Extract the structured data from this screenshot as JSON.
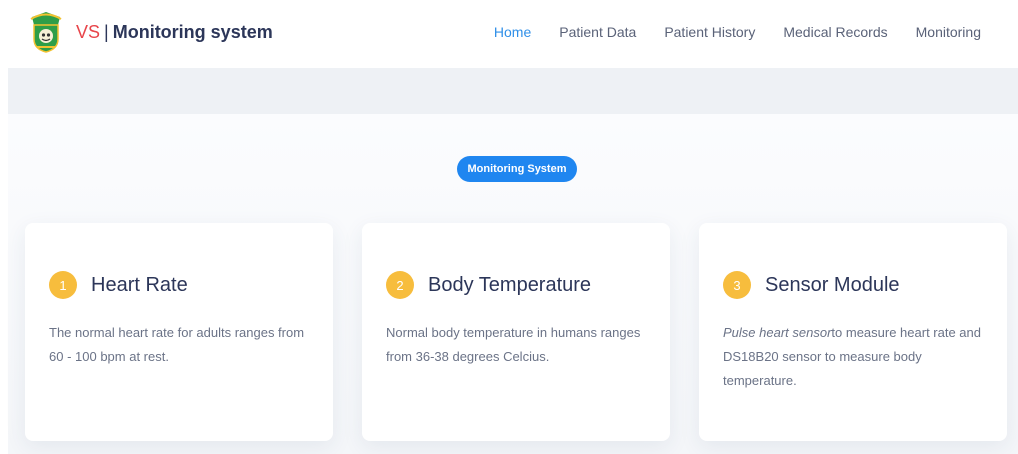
{
  "brand": {
    "vs": "VS",
    "separator": "|",
    "name": "Monitoring system"
  },
  "nav": {
    "items": [
      {
        "label": "Home",
        "active": true
      },
      {
        "label": "Patient Data",
        "active": false
      },
      {
        "label": "Patient History",
        "active": false
      },
      {
        "label": "Medical Records",
        "active": false
      },
      {
        "label": "Monitoring",
        "active": false
      }
    ]
  },
  "section": {
    "badge": "Monitoring System"
  },
  "cards": [
    {
      "number": "1",
      "title": "Heart Rate",
      "text": "The normal heart rate for adults ranges from 60 - 100 bpm at rest."
    },
    {
      "number": "2",
      "title": "Body Temperature",
      "text": "Normal body temperature in humans ranges from 36-38 degrees Celcius."
    },
    {
      "number": "3",
      "title": "Sensor Module",
      "text_italic": "Pulse heart sensor",
      "text": "to measure heart rate and DS18B20 sensor to measure body temperature."
    }
  ],
  "colors": {
    "accent": "#1f86f0",
    "brand_vs": "#e8454a",
    "number_badge": "#f7bd3d",
    "nav_active": "#2f8fe8"
  }
}
